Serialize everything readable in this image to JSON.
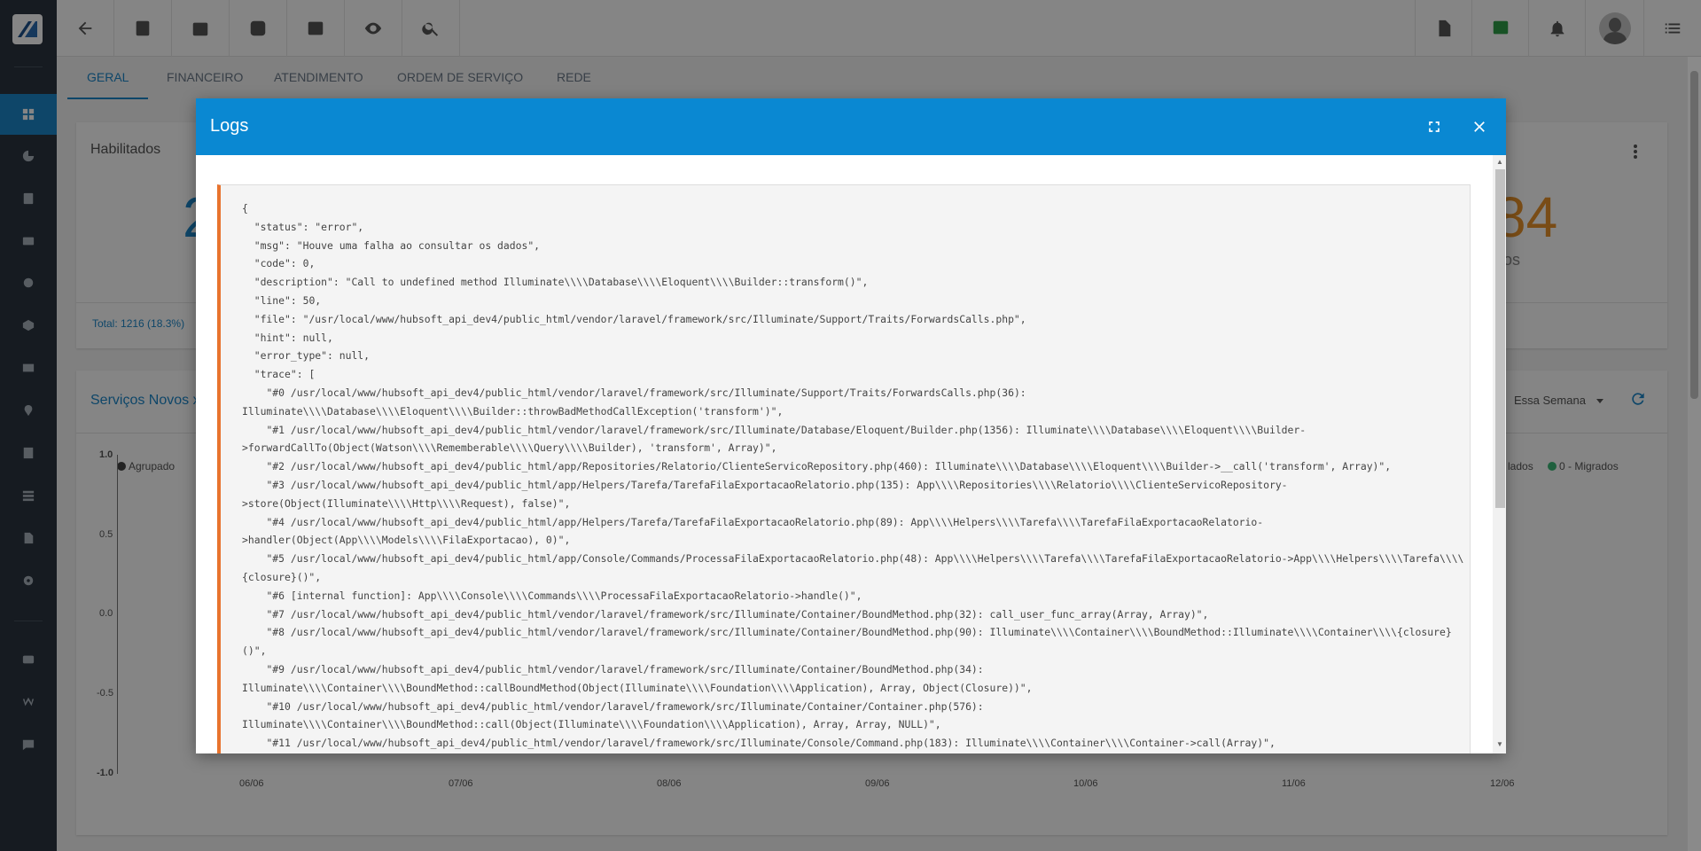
{
  "tabs": [
    {
      "label": "GERAL"
    },
    {
      "label": "FINANCEIRO"
    },
    {
      "label": "ATENDIMENTO"
    },
    {
      "label": "ORDEM DE SERVIÇO"
    },
    {
      "label": "REDE"
    }
  ],
  "habilitados": {
    "title": "Habilitados",
    "number_left": "2",
    "number_right": "84",
    "suffix_right": "os",
    "total": "Total: 1216 (18.3%)"
  },
  "servicos": {
    "title": "Serviços Novos x",
    "period": "Essa Semana",
    "legend_left": "Agrupado",
    "legend_right_1": "lados",
    "legend_right_2": "0 - Migrados",
    "y_ticks": [
      "1.0",
      "0.5",
      "0.0",
      "-0.5",
      "-1.0"
    ],
    "x_ticks": [
      "06/06",
      "07/06",
      "08/06",
      "09/06",
      "10/06",
      "11/06",
      "12/06"
    ]
  },
  "modal": {
    "title": "Logs",
    "log_text": "{\n  \"status\": \"error\",\n  \"msg\": \"Houve uma falha ao consultar os dados\",\n  \"code\": 0,\n  \"description\": \"Call to undefined method Illuminate\\\\\\\\Database\\\\\\\\Eloquent\\\\\\\\Builder::transform()\",\n  \"line\": 50,\n  \"file\": \"/usr/local/www/hubsoft_api_dev4/public_html/vendor/laravel/framework/src/Illuminate/Support/Traits/ForwardsCalls.php\",\n  \"hint\": null,\n  \"error_type\": null,\n  \"trace\": [\n    \"#0 /usr/local/www/hubsoft_api_dev4/public_html/vendor/laravel/framework/src/Illuminate/Support/Traits/ForwardsCalls.php(36):\nIlluminate\\\\\\\\Database\\\\\\\\Eloquent\\\\\\\\Builder::throwBadMethodCallException('transform')\",\n    \"#1 /usr/local/www/hubsoft_api_dev4/public_html/vendor/laravel/framework/src/Illuminate/Database/Eloquent/Builder.php(1356): Illuminate\\\\\\\\Database\\\\\\\\Eloquent\\\\\\\\Builder-\n>forwardCallTo(Object(Watson\\\\\\\\Rememberable\\\\\\\\Query\\\\\\\\Builder), 'transform', Array)\",\n    \"#2 /usr/local/www/hubsoft_api_dev4/public_html/app/Repositories/Relatorio/ClienteServicoRepository.php(460): Illuminate\\\\\\\\Database\\\\\\\\Eloquent\\\\\\\\Builder->__call('transform', Array)\",\n    \"#3 /usr/local/www/hubsoft_api_dev4/public_html/app/Helpers/Tarefa/TarefaFilaExportacaoRelatorio.php(135): App\\\\\\\\Repositories\\\\\\\\Relatorio\\\\\\\\ClienteServicoRepository-\n>store(Object(Illuminate\\\\\\\\Http\\\\\\\\Request), false)\",\n    \"#4 /usr/local/www/hubsoft_api_dev4/public_html/app/Helpers/Tarefa/TarefaFilaExportacaoRelatorio.php(89): App\\\\\\\\Helpers\\\\\\\\Tarefa\\\\\\\\TarefaFilaExportacaoRelatorio-\n>handler(Object(App\\\\\\\\Models\\\\\\\\FilaExportacao), 0)\",\n    \"#5 /usr/local/www/hubsoft_api_dev4/public_html/app/Console/Commands/ProcessaFilaExportacaoRelatorio.php(48): App\\\\\\\\Helpers\\\\\\\\Tarefa\\\\\\\\TarefaFilaExportacaoRelatorio->App\\\\\\\\Helpers\\\\\\\\Tarefa\\\\\\\\\n{closure}()\",\n    \"#6 [internal function]: App\\\\\\\\Console\\\\\\\\Commands\\\\\\\\ProcessaFilaExportacaoRelatorio->handle()\",\n    \"#7 /usr/local/www/hubsoft_api_dev4/public_html/vendor/laravel/framework/src/Illuminate/Container/BoundMethod.php(32): call_user_func_array(Array, Array)\",\n    \"#8 /usr/local/www/hubsoft_api_dev4/public_html/vendor/laravel/framework/src/Illuminate/Container/BoundMethod.php(90): Illuminate\\\\\\\\Container\\\\\\\\BoundMethod::Illuminate\\\\\\\\Container\\\\\\\\{closure}\n()\",\n    \"#9 /usr/local/www/hubsoft_api_dev4/public_html/vendor/laravel/framework/src/Illuminate/Container/BoundMethod.php(34):\nIlluminate\\\\\\\\Container\\\\\\\\BoundMethod::callBoundMethod(Object(Illuminate\\\\\\\\Foundation\\\\\\\\Application), Array, Object(Closure))\",\n    \"#10 /usr/local/www/hubsoft_api_dev4/public_html/vendor/laravel/framework/src/Illuminate/Container/Container.php(576):\nIlluminate\\\\\\\\Container\\\\\\\\BoundMethod::call(Object(Illuminate\\\\\\\\Foundation\\\\\\\\Application), Array, Array, NULL)\",\n    \"#11 /usr/local/www/hubsoft_api_dev4/public_html/vendor/laravel/framework/src/Illuminate/Console/Command.php(183): Illuminate\\\\\\\\Container\\\\\\\\Container->call(Array)\","
  },
  "colors": {
    "accent": "#0a88d2",
    "sidebar": "#2b3540",
    "log_border": "#e8732e",
    "number_blue": "#1c87c9",
    "number_orange": "#e8922b"
  },
  "icons": {
    "sidebar": [
      "dashboard-icon",
      "pie-chart-icon",
      "contact-card-icon",
      "wallet-icon",
      "calendar-clock-icon",
      "box-icon",
      "money-icon",
      "map-pin-icon",
      "document-icon",
      "list-icon",
      "file-icon",
      "settings-icon",
      "video-icon",
      "wiki-icon",
      "chat-icon"
    ],
    "topbar": [
      "back-icon",
      "contact-icon",
      "schedule-icon",
      "dollar-icon",
      "terminal-icon",
      "eye-icon",
      "search-icon",
      "pdf-icon",
      "check-message-icon",
      "bell-icon",
      "avatar",
      "menu-list-icon"
    ]
  }
}
